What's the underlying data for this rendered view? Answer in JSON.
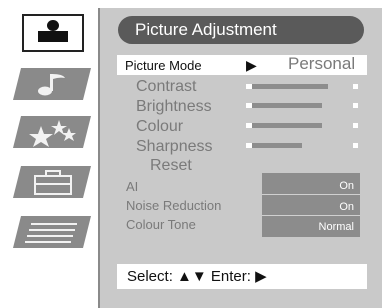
{
  "tabs": [
    {
      "icon": "person-icon",
      "active": true
    },
    {
      "icon": "music-note-icon",
      "active": false
    },
    {
      "icon": "stars-icon",
      "active": false
    },
    {
      "icon": "toolbox-icon",
      "active": false
    },
    {
      "icon": "document-lines-icon",
      "active": false
    }
  ],
  "menu": {
    "title": "Picture Adjustment",
    "picture_mode": {
      "label": "Picture Mode",
      "arrow": "▶",
      "value": "Personal"
    },
    "sliders": [
      {
        "label": "Contrast",
        "level": 0.75
      },
      {
        "label": "Brightness",
        "level": 0.68
      },
      {
        "label": "Colour",
        "level": 0.7
      },
      {
        "label": "Sharpness",
        "level": 0.45
      }
    ],
    "reset_label": "Reset",
    "options": [
      {
        "label": "AI",
        "value": "On"
      },
      {
        "label": "Noise Reduction",
        "value": "On"
      },
      {
        "label": "Colour Tone",
        "value": "Normal"
      }
    ]
  },
  "footer": {
    "select_label": "Select:",
    "select_arrows": "▲▼",
    "enter_label": "Enter:",
    "enter_arrow": "▶"
  },
  "colors": {
    "panel": "#c9c9c9",
    "title_pill": "#5a5a5a",
    "option_box": "#8c8c8c",
    "slider_fill": "#8d8d8d",
    "tab_icon": "#8a8a8a"
  }
}
